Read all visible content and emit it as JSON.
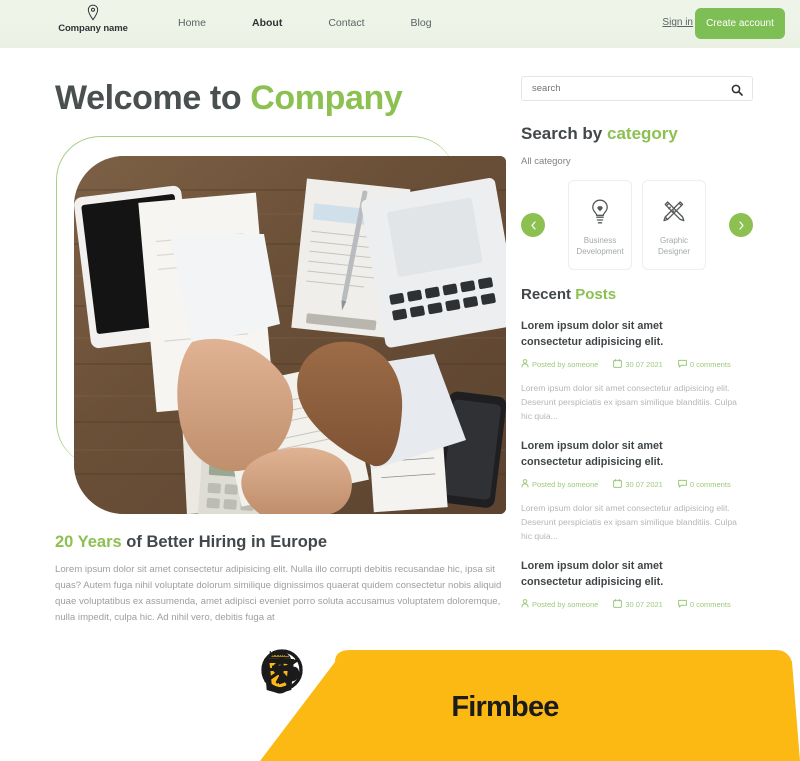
{
  "header": {
    "brand": {
      "icon": "location-pin-icon",
      "name": "Company name"
    },
    "nav": [
      {
        "label": "Home",
        "active": false
      },
      {
        "label": "About",
        "active": true
      },
      {
        "label": "Contact",
        "active": false
      },
      {
        "label": "Blog",
        "active": false
      }
    ],
    "sign_in_label": "Sign in",
    "create_account_label": "Create account",
    "accent_color": "#7dbe55",
    "background_color": "#eef4e8"
  },
  "hero": {
    "title_plain": "Welcome to ",
    "title_accent": "Company",
    "image_alt": "fist-bump-over-desk-photo"
  },
  "article": {
    "title_accent": "20 Years ",
    "title_plain": "of Better Hiring in Europe",
    "body": "Lorem ipsum dolor sit amet consectetur adipisicing elit. Nulla illo corrupti debitis recusandae hic, ipsa sit quas? Autem fuga nihil voluptate dolorum similique dignissimos quaerat quidem consectetur nobis aliquid quae voluptatibus ex assumenda, amet adipisci eveniet porro soluta accusamus voluptatem doloremque, nulla impedit, culpa hic. Ad nihil vero, debitis fuga at"
  },
  "sidebar": {
    "search": {
      "value": "",
      "placeholder": "search",
      "icon": "search-icon"
    },
    "category": {
      "heading_plain": "Search by ",
      "heading_accent": "category",
      "all_label": "All category",
      "prev_icon": "chevron-left-icon",
      "next_icon": "chevron-right-icon",
      "cards": [
        {
          "icon": "lightbulb-icon",
          "label": "Business Development"
        },
        {
          "icon": "pencil-ruler-icon",
          "label": "Graphic Designer"
        }
      ]
    },
    "recent": {
      "heading_plain": "Recent ",
      "heading_accent": "Posts",
      "posts": [
        {
          "title": "Lorem ipsum dolor sit amet consectetur adipisicing elit.",
          "author": "Posted by someone",
          "date": "30 07 2021",
          "comments": "0 comments",
          "excerpt": "Lorem ipsum dolor sit amet consectetur adipisicing elit. Deserunt perspiciatis ex ipsam similique blanditiis. Culpa hic quia..."
        },
        {
          "title": "Lorem ipsum dolor sit amet consectetur adipisicing elit.",
          "author": "Posted by someone",
          "date": "30 07 2021",
          "comments": "0 comments",
          "excerpt": "Lorem ipsum dolor sit amet consectetur adipisicing elit. Deserunt perspiciatis ex ipsam similique blanditiis. Culpa hic quia..."
        },
        {
          "title": "Lorem ipsum dolor sit amet consectetur adipisicing elit.",
          "author": "Posted by someone",
          "date": "30 07 2021",
          "comments": "0 comments",
          "excerpt": ""
        }
      ],
      "meta_icons": {
        "author": "person-icon",
        "date": "calendar-icon",
        "comments": "comment-bubble-icon"
      }
    }
  },
  "banner": {
    "background_color": "#FCB813",
    "brand_name": "Firmbee",
    "logos": [
      {
        "name": "firmbee-bee-logo"
      },
      {
        "name": "html5-badge-icon"
      },
      {
        "name": "sass-circle-icon"
      },
      {
        "name": "accessibility-person-icon"
      }
    ]
  }
}
